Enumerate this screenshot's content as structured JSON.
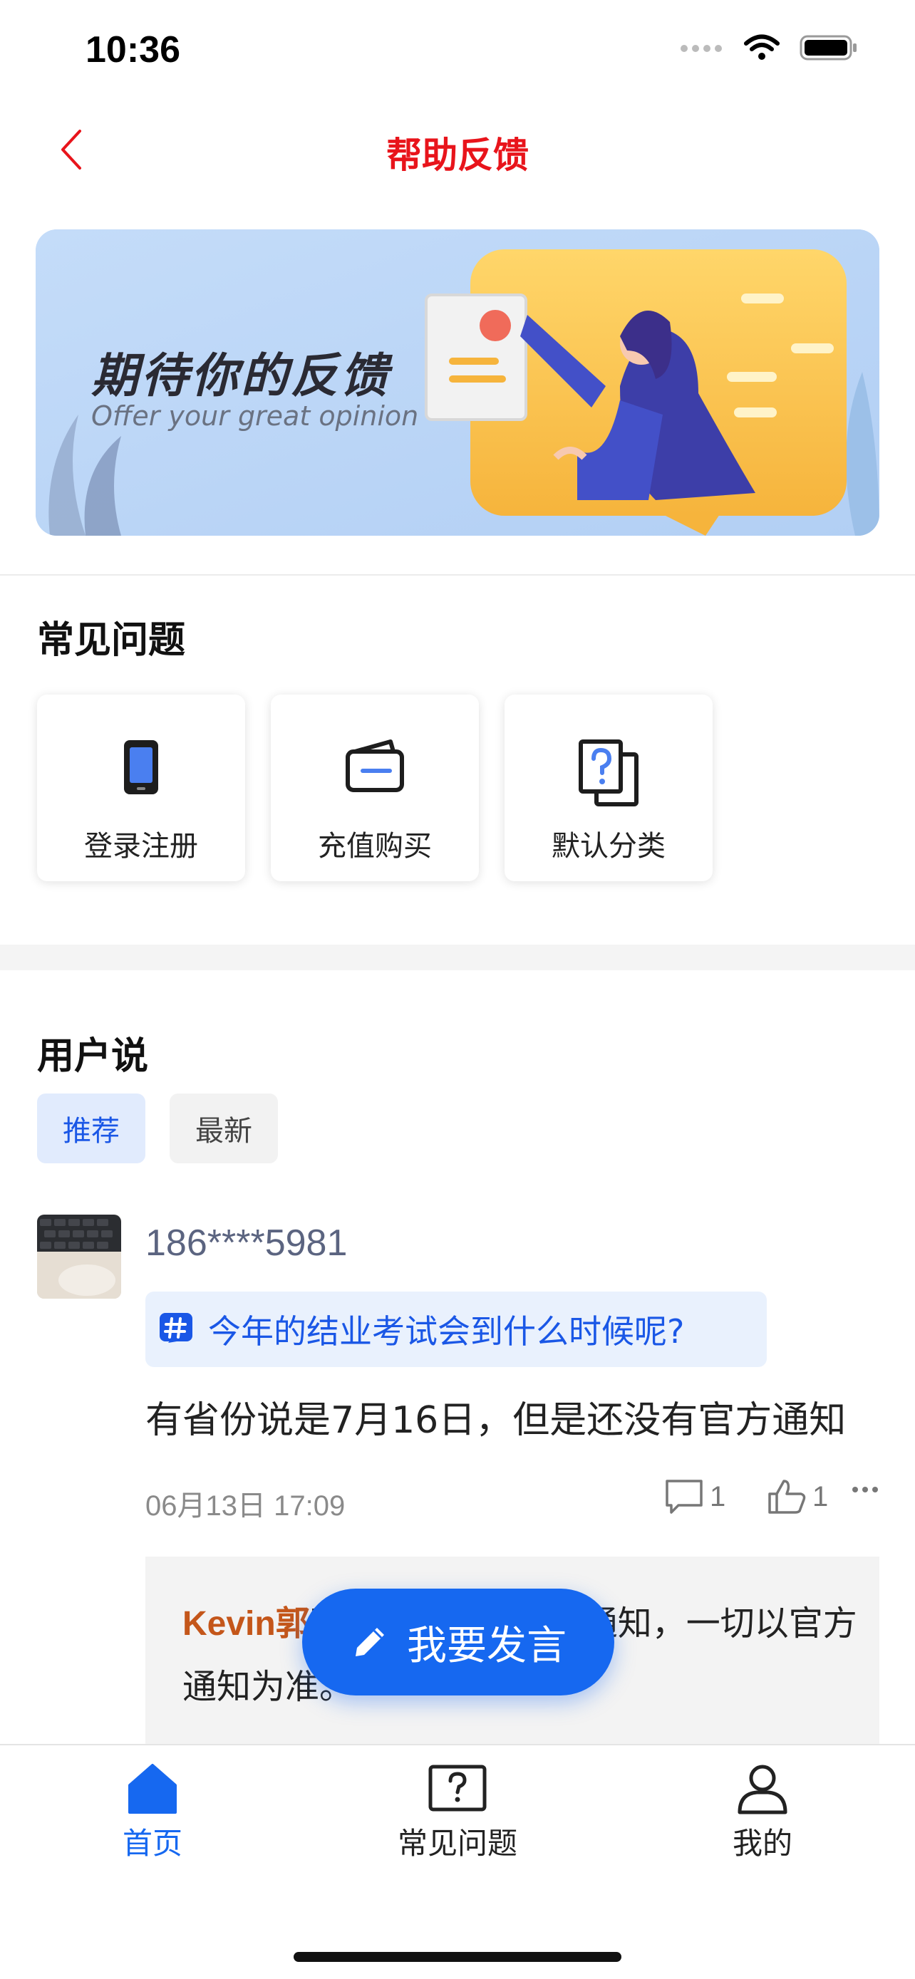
{
  "status_bar": {
    "time": "10:36"
  },
  "nav": {
    "title": "帮助反馈"
  },
  "banner": {
    "title": "期待你的反馈",
    "subtitle": "Offer your great opinion"
  },
  "faq": {
    "title": "常见问题",
    "items": [
      {
        "label": "登录注册",
        "icon": "phone-icon"
      },
      {
        "label": "充值购买",
        "icon": "wallet-icon"
      },
      {
        "label": "默认分类",
        "icon": "question-doc-icon"
      }
    ]
  },
  "users": {
    "title": "用户说",
    "tabs": [
      {
        "label": "推荐",
        "active": true
      },
      {
        "label": "最新",
        "active": false
      }
    ],
    "post": {
      "username": "186****5981",
      "topic": "今年的结业考试会到什么时候呢?",
      "body": "有省份说是7月16日，但是还没有官方通知",
      "time": "06月13日 17:09",
      "comment_count": "1",
      "like_count": "1",
      "reply_name": "Kevin郭",
      "reply_text": "不用着急，等官方通知，一切以官方通知为准。"
    }
  },
  "fab": {
    "label": "我要发言"
  },
  "tabbar": {
    "items": [
      {
        "label": "首页",
        "icon": "home-icon",
        "active": true
      },
      {
        "label": "常见问题",
        "icon": "question-box-icon",
        "active": false
      },
      {
        "label": "我的",
        "icon": "user-icon",
        "active": false
      }
    ]
  },
  "colors": {
    "accent": "#1668f0",
    "title_red": "#e8141b",
    "topic_bg": "#e9f1fd"
  }
}
